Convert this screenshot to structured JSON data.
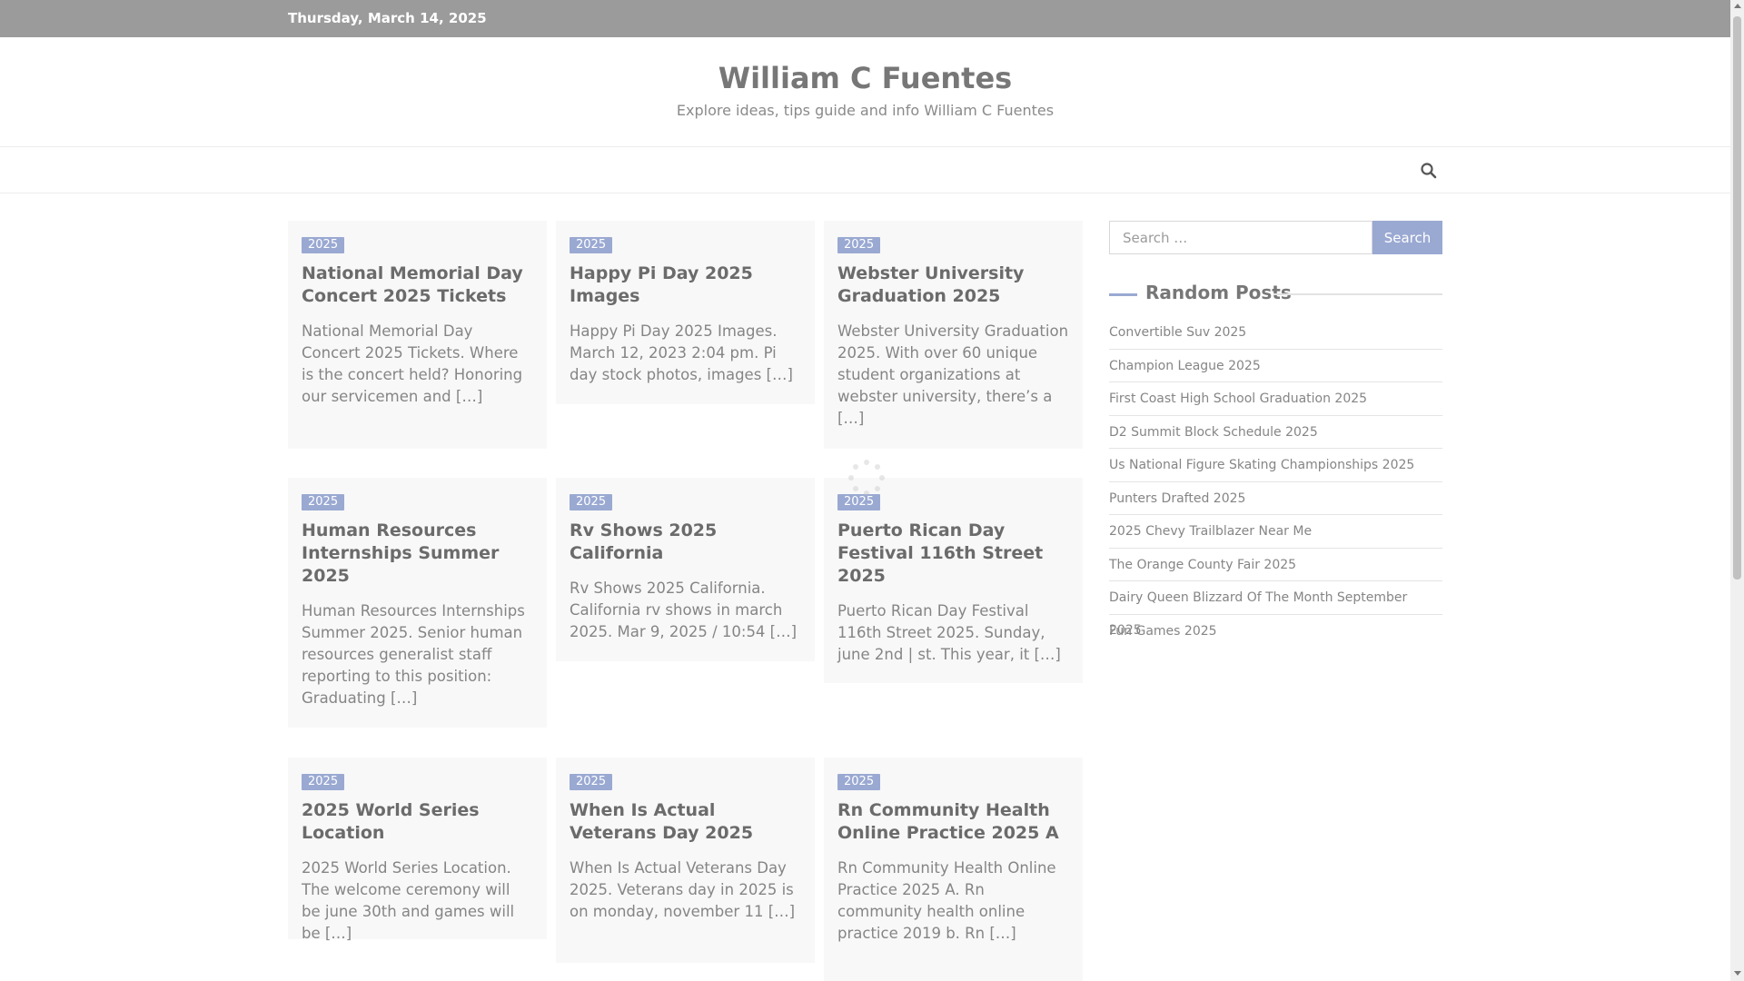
{
  "topbar": {
    "date": "Thursday, March 14, 2025"
  },
  "header": {
    "site_title": "William C Fuentes",
    "site_description": "Explore ideas, tips guide and info William C Fuentes"
  },
  "nav": {
    "search_icon": "search-icon"
  },
  "posts": [
    {
      "category": "2025",
      "title": "National Memorial Day Concert 2025 Tickets",
      "excerpt": "National Memorial Day Concert 2025 Tickets. Where is the concert held? Honoring our servicemen and […]"
    },
    {
      "category": "2025",
      "title": "Happy Pi Day 2025 Images",
      "excerpt": "Happy Pi Day 2025 Images. March 12, 2023 2:04 pm. Pi day stock photos, images […]"
    },
    {
      "category": "2025",
      "title": "Webster University Graduation 2025",
      "excerpt": "Webster University Graduation 2025. With over 60 unique student organizations at webster university, there’s a […]"
    },
    {
      "category": "2025",
      "title": "Human Resources Internships Summer 2025",
      "excerpt": "Human Resources Internships Summer 2025. Senior human resources generalist staff reporting to this position: Graduating […]"
    },
    {
      "category": "2025",
      "title": "Rv Shows 2025 California",
      "excerpt": "Rv Shows 2025 California. California rv shows in march 2025. Mar 9, 2025 / 10:54 […]"
    },
    {
      "category": "2025",
      "title": "Puerto Rican Day Festival 116th Street 2025",
      "excerpt": "Puerto Rican Day Festival 116th Street 2025. Sunday, june 2nd | st. This year, it […]"
    },
    {
      "category": "2025",
      "title": "2025 World Series Location",
      "excerpt": "2025 World Series Location. The welcome ceremony will be june 30th and games will be […]"
    },
    {
      "category": "2025",
      "title": "When Is Actual Veterans Day 2025",
      "excerpt": "When Is Actual Veterans Day 2025. Veterans day in 2025 is on monday, november 11 […]"
    },
    {
      "category": "2025",
      "title": "Rn Community Health Online Practice 2025 A",
      "excerpt": "Rn Community Health Online Practice 2025 A. Rn community health online practice 2019 b. Rn […]"
    }
  ],
  "sidebar": {
    "search_placeholder": "Search …",
    "search_button": "Search",
    "widget_title": "Random Posts",
    "random_posts": [
      "Convertible Suv 2025",
      "Champion League 2025",
      "First Coast High School Graduation 2025",
      "D2 Summit Block Schedule 2025",
      "Us National Figure Skating Championships 2025",
      "Punters Drafted 2025",
      "2025 Chevy Trailblazer Near Me",
      "The Orange County Fair 2025",
      "Dairy Queen Blizzard Of The Month September 2025",
      "Fun Games 2025"
    ]
  },
  "colors": {
    "accent": "#9aa9d2",
    "topbar": "#9b9b9b",
    "card_bg": "#f8f8f8"
  }
}
